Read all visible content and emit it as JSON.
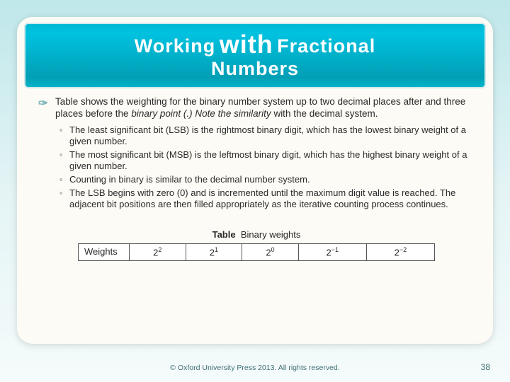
{
  "title": {
    "word1": "Working",
    "word2": "with",
    "word3": "Fractional",
    "line2": "Numbers"
  },
  "lead": {
    "part1": "Table shows the weighting for the binary number system up to two decimal places after and three places before the ",
    "italic1": "binary point (.)",
    "part2": " ",
    "italic2": "Note the similarity",
    "part3": " with the decimal system."
  },
  "subpoints": [
    "The least significant bit (LSB) is the rightmost binary digit, which has the lowest binary weight of a given number.",
    "The most significant bit (MSB) is the leftmost binary digit, which has the highest binary weight of a given number.",
    "Counting in binary is similar to the decimal number system.",
    "The LSB begins with zero (0) and is incremented until the maximum digit value is reached. The adjacent bit positions are then filled appropriately as the iterative counting process continues."
  ],
  "table": {
    "caption_bold": "Table",
    "caption_rest": "Binary weights",
    "row_label": "Weights",
    "cells": [
      {
        "base": "2",
        "exp": "2"
      },
      {
        "base": "2",
        "exp": "1"
      },
      {
        "base": "2",
        "exp": "0"
      },
      {
        "base": "2",
        "exp": "−1"
      },
      {
        "base": "2",
        "exp": "−2"
      }
    ]
  },
  "footer": {
    "copyright": "© Oxford University Press 2013. All rights reserved.",
    "page": "38"
  }
}
